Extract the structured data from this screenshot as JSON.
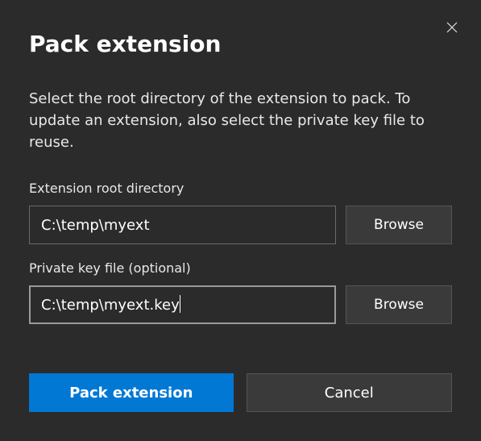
{
  "dialog": {
    "title": "Pack extension",
    "description": "Select the root directory of the extension to pack. To update an extension, also select the private key file to reuse."
  },
  "fields": {
    "root_dir": {
      "label": "Extension root directory",
      "value": "C:\\temp\\myext",
      "browse_label": "Browse"
    },
    "private_key": {
      "label": "Private key file (optional)",
      "value": "C:\\temp\\myext.key",
      "browse_label": "Browse"
    }
  },
  "buttons": {
    "primary": "Pack extension",
    "secondary": "Cancel"
  },
  "colors": {
    "accent": "#0078d4",
    "background": "#2b2b2b",
    "button_bg": "#3a3a3a"
  }
}
